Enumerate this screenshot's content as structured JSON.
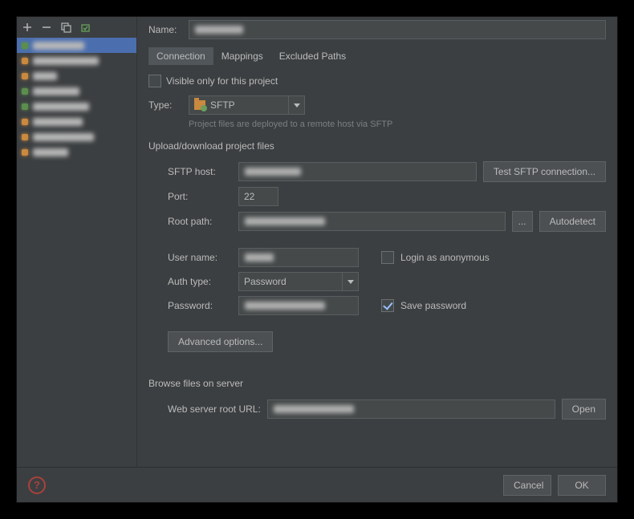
{
  "sidebar": {
    "items": [
      {
        "color": "green"
      },
      {
        "color": "orange"
      },
      {
        "color": "orange"
      },
      {
        "color": "green"
      },
      {
        "color": "green"
      },
      {
        "color": "orange"
      },
      {
        "color": "orange"
      },
      {
        "color": "orange"
      }
    ]
  },
  "main": {
    "name_label": "Name:",
    "tabs": {
      "connection": "Connection",
      "mappings": "Mappings",
      "excluded": "Excluded Paths"
    },
    "visible_only_label": "Visible only for this project",
    "type_label": "Type:",
    "type_value": "SFTP",
    "type_helper": "Project files are deployed to a remote host via SFTP",
    "section_upload": "Upload/download project files",
    "sftp_host_label": "SFTP host:",
    "test_btn": "Test SFTP connection...",
    "port_label": "Port:",
    "port_value": "22",
    "root_path_label": "Root path:",
    "root_browse": "...",
    "autodetect": "Autodetect",
    "user_name_label": "User name:",
    "login_anonymous": "Login as anonymous",
    "auth_type_label": "Auth type:",
    "auth_type_value": "Password",
    "password_label": "Password:",
    "save_password": "Save password",
    "advanced": "Advanced options...",
    "section_browse": "Browse files on server",
    "web_root_label": "Web server root URL:",
    "open": "Open"
  },
  "footer": {
    "help": "?",
    "cancel": "Cancel",
    "ok": "OK"
  }
}
